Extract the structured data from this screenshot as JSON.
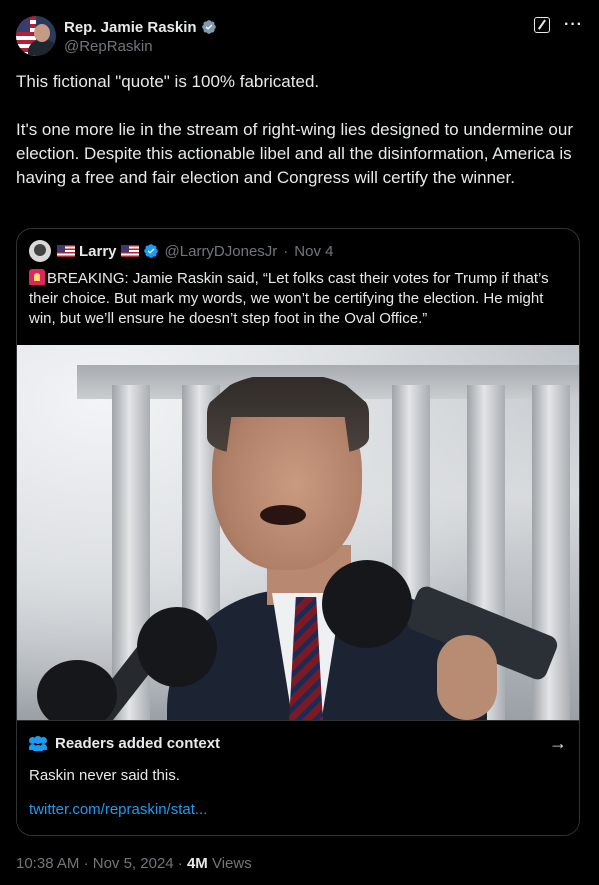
{
  "author": {
    "name": "Rep. Jamie Raskin",
    "handle": "@RepRaskin"
  },
  "tweet": {
    "text": "This fictional \"quote\" is 100% fabricated.\n\nIt's one more lie in the stream of right-wing lies designed to undermine our election. Despite this actionable libel and all the disinformation, America is having a free and fair election and Congress will certify the winner."
  },
  "quoted": {
    "name": "Larry",
    "handle": "@LarryDJonesJr",
    "separator": "·",
    "date": "Nov 4",
    "text": "BREAKING: Jamie Raskin said, “Let folks cast their votes for Trump if that’s their choice. But mark my words, we won’t be certifying the election. He might win, but we’ll ensure he doesn’t step foot in the Oval Office.”"
  },
  "context": {
    "title": "Readers added context",
    "note": "Raskin never said this.",
    "link": "twitter.com/repraskin/stat..."
  },
  "meta": {
    "time": "10:38 AM",
    "sep1": "·",
    "date": "Nov 5, 2024",
    "sep2": "·",
    "views_count": "4M",
    "views_label": "Views"
  },
  "colors": {
    "background": "#000000",
    "text": "#e7e9ea",
    "muted": "#71767b",
    "accent": "#1d9bf0",
    "border": "#2f3336"
  },
  "icons": [
    "verified-badge-icon",
    "grok-icon",
    "more-icon",
    "flag-icon",
    "siren-icon",
    "people-icon",
    "arrow-right-icon"
  ]
}
